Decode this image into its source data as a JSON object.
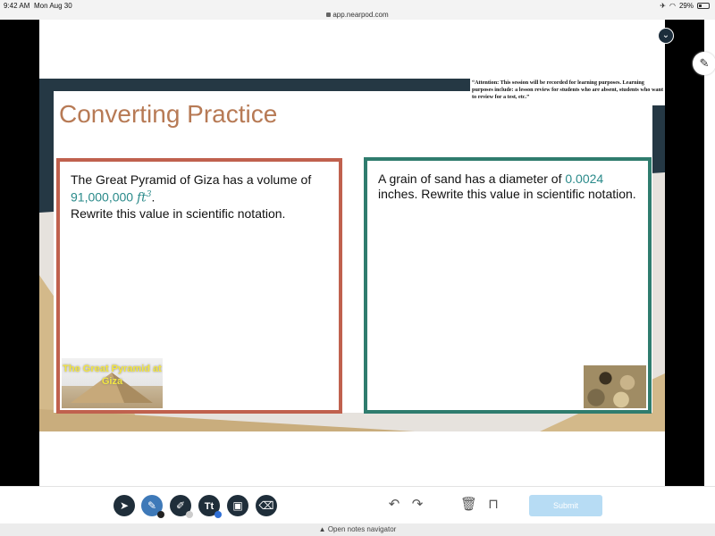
{
  "status_bar": {
    "time": "9:42 AM",
    "date": "Mon Aug 30",
    "battery": "29%",
    "url": "app.nearpod.com"
  },
  "slide": {
    "title": "Converting Practice",
    "notice": "“Attention: This session will be recorded for learning purposes. Learning purposes include: a lesson review for students who are absent, students who want to review for a test, etc.”",
    "left_card": {
      "line1": "The Great Pyramid of Giza has a volume of",
      "value": "91,000,000",
      "unit": "ft",
      "exponent": "3",
      "period": ".",
      "line3": "Rewrite this value in scientific notation.",
      "image_caption": "The Great Pyramid at Giza"
    },
    "right_card": {
      "text_before": "A grain of sand has a diameter of ",
      "value": "0.0024",
      "text_after": "inches.  Rewrite this value in scientific notation."
    }
  },
  "toolbar": {
    "tools": [
      "pointer-icon",
      "pen-icon",
      "highlighter-icon",
      "text-icon",
      "image-icon",
      "eraser-icon"
    ],
    "text_tool_label": "Tt",
    "actions": [
      "undo-icon",
      "redo-icon",
      "trash-icon",
      "unlock-icon"
    ],
    "submit_label": "Submit"
  },
  "notes_navigator": {
    "label": "Open notes navigator"
  },
  "colors": {
    "title": "#b77a55",
    "left_border": "#c0614e",
    "right_border": "#2f7c6e",
    "teal_value": "#2a8a8a",
    "tool_bg": "#1f2e3a",
    "tool_active": "#3e79b8",
    "submit_bg": "#b7dcf4"
  }
}
